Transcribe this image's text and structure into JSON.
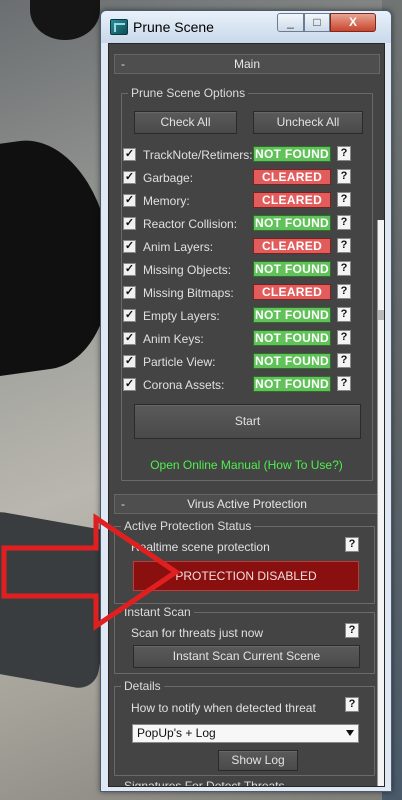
{
  "window": {
    "title": "Prune Scene",
    "min": "_",
    "max": "□",
    "close": "X"
  },
  "main": {
    "header": "Main",
    "collapse": "-",
    "group_title": "Prune Scene Options",
    "check_all": "Check All",
    "uncheck_all": "Uncheck All",
    "items": [
      {
        "label": "TrackNote/Retimers:",
        "status": "NOT FOUND",
        "status_type": "nf",
        "checked": "✓",
        "help": "?"
      },
      {
        "label": "Garbage:",
        "status": "CLEARED",
        "status_type": "cl",
        "checked": "✓",
        "help": "?"
      },
      {
        "label": "Memory:",
        "status": "CLEARED",
        "status_type": "cl",
        "checked": "✓",
        "help": "?"
      },
      {
        "label": "Reactor Collision:",
        "status": "NOT FOUND",
        "status_type": "nf",
        "checked": "✓",
        "help": "?"
      },
      {
        "label": "Anim Layers:",
        "status": "CLEARED",
        "status_type": "cl",
        "checked": "✓",
        "help": "?"
      },
      {
        "label": "Missing Objects:",
        "status": "NOT FOUND",
        "status_type": "nf",
        "checked": "✓",
        "help": "?"
      },
      {
        "label": "Missing Bitmaps:",
        "status": "CLEARED",
        "status_type": "cl",
        "checked": "✓",
        "help": "?"
      },
      {
        "label": "Empty Layers:",
        "status": "NOT FOUND",
        "status_type": "nf",
        "checked": "✓",
        "help": "?"
      },
      {
        "label": "Anim Keys:",
        "status": "NOT FOUND",
        "status_type": "nf",
        "checked": "✓",
        "help": "?"
      },
      {
        "label": "Particle View:",
        "status": "NOT FOUND",
        "status_type": "nf",
        "checked": "✓",
        "help": "?"
      },
      {
        "label": "Corona Assets:",
        "status": "NOT FOUND",
        "status_type": "nf",
        "checked": "✓",
        "help": "?"
      }
    ],
    "start": "Start",
    "manual_link": "Open Online Manual (How To Use?)"
  },
  "virus": {
    "header": "Virus Active Protection",
    "collapse": "-",
    "status_group": "Active Protection Status",
    "realtime_label": "Realtime scene protection",
    "protection_button": "PROTECTION DISABLED",
    "instant_group": "Instant Scan",
    "scan_label": "Scan for threats just now",
    "scan_button": "Instant Scan Current Scene",
    "details_group": "Details",
    "notify_label": "How to notify when detected threat",
    "notify_value": "PopUp's + Log",
    "show_log": "Show Log",
    "signatures_group": "Signatures For Detect Threats",
    "help": "?"
  },
  "colors": {
    "not_found": "#61c25a",
    "cleared": "#e25c5c",
    "protection": "#8a1010",
    "link": "#4df04d",
    "arrow": "#e02020"
  }
}
